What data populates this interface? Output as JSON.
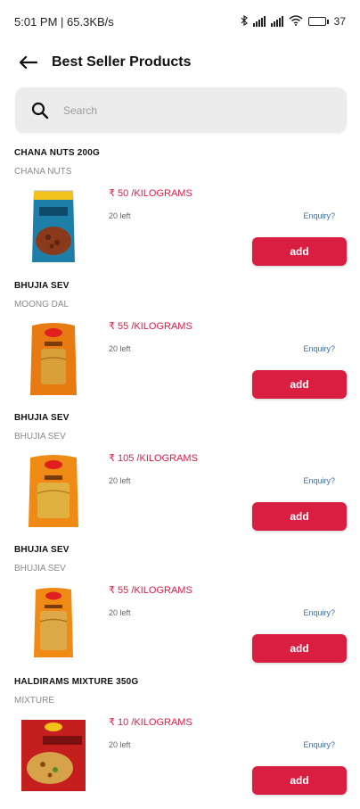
{
  "status": {
    "time_speed": "5:01 PM | 65.3KB/s",
    "battery_pct": "37",
    "battery_level": 0.37
  },
  "header": {
    "title": "Best Seller Products"
  },
  "search": {
    "placeholder": "Search"
  },
  "products": [
    {
      "name": "CHANA NUTS 200G",
      "sub": "CHANA NUTS",
      "price": "₹ 50 /KILOGRAMS",
      "stock": "20 left",
      "enquiry": "Enquiry?",
      "add": "add"
    },
    {
      "name": "BHUJIA SEV",
      "sub": "MOONG DAL",
      "price": "₹ 55 /KILOGRAMS",
      "stock": "20 left",
      "enquiry": "Enquiry?",
      "add": "add"
    },
    {
      "name": "BHUJIA SEV",
      "sub": "BHUJIA SEV",
      "price": "₹ 105 /KILOGRAMS",
      "stock": "20 left",
      "enquiry": "Enquiry?",
      "add": "add"
    },
    {
      "name": "BHUJIA SEV",
      "sub": "BHUJIA SEV",
      "price": "₹ 55 /KILOGRAMS",
      "stock": "20 left",
      "enquiry": "Enquiry?",
      "add": "add"
    },
    {
      "name": "HALDIRAMS MIXTURE   350G",
      "sub": "MIXTURE",
      "price": "₹ 10 /KILOGRAMS",
      "stock": "20 left",
      "enquiry": "Enquiry?",
      "add": "add"
    }
  ],
  "colors": {
    "accent": "#d91e42",
    "price": "#d3214a",
    "link": "#3f6fa8"
  }
}
